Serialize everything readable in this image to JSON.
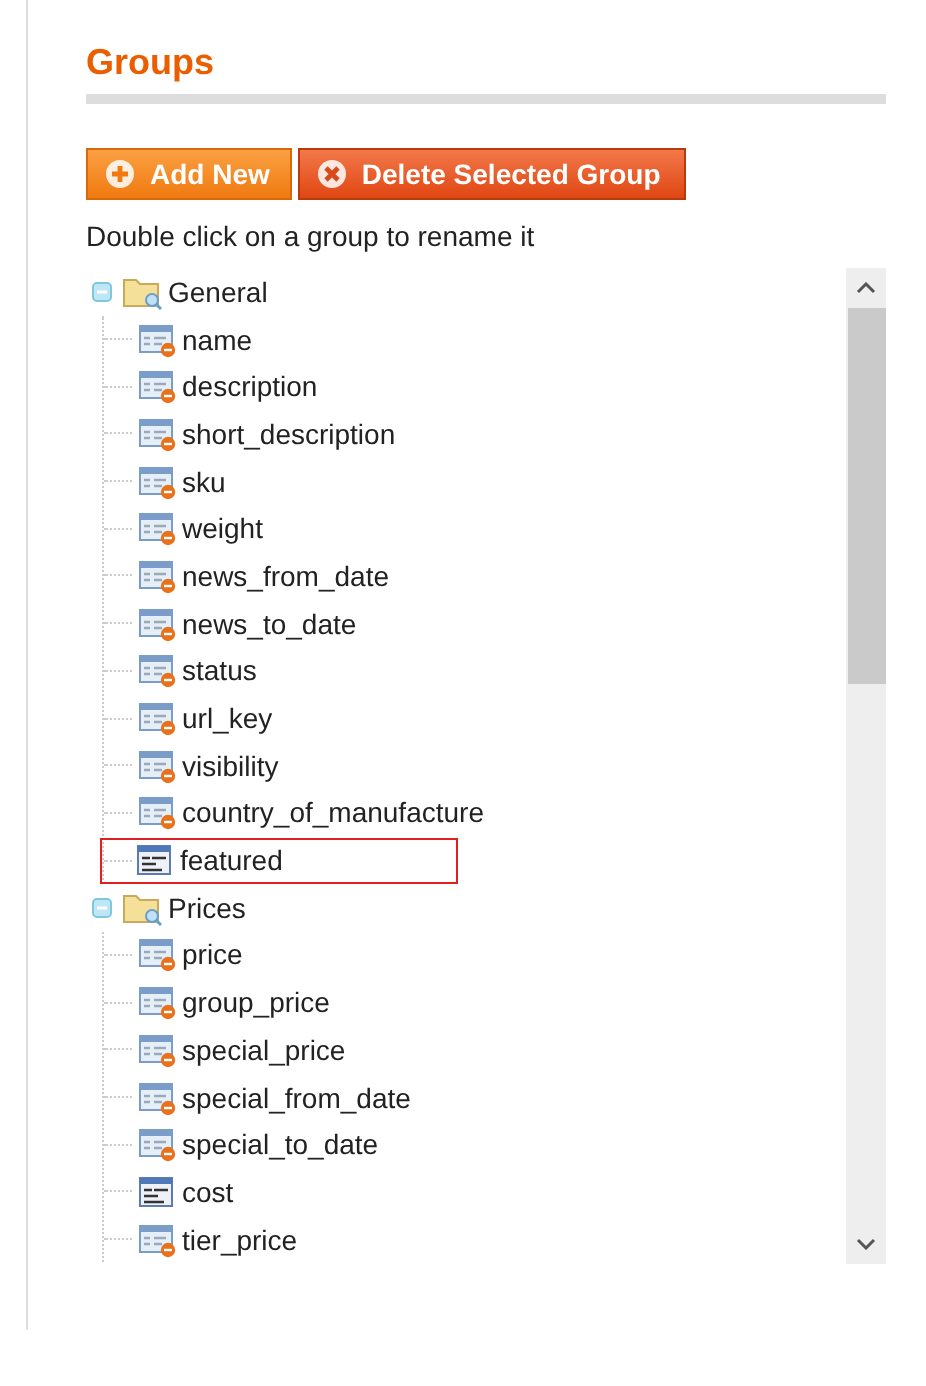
{
  "title": "Groups",
  "buttons": [
    {
      "label": "Add New",
      "kind": "add"
    },
    {
      "label": "Delete Selected Group",
      "kind": "delete"
    }
  ],
  "hint": "Double click on a group to rename it",
  "tree": [
    {
      "label": "General",
      "expanded": true,
      "children": [
        {
          "label": "name",
          "kind": "system",
          "selected": false
        },
        {
          "label": "description",
          "kind": "system",
          "selected": false
        },
        {
          "label": "short_description",
          "kind": "system",
          "selected": false
        },
        {
          "label": "sku",
          "kind": "system",
          "selected": false
        },
        {
          "label": "weight",
          "kind": "system",
          "selected": false
        },
        {
          "label": "news_from_date",
          "kind": "system",
          "selected": false
        },
        {
          "label": "news_to_date",
          "kind": "system",
          "selected": false
        },
        {
          "label": "status",
          "kind": "system",
          "selected": false
        },
        {
          "label": "url_key",
          "kind": "system",
          "selected": false
        },
        {
          "label": "visibility",
          "kind": "system",
          "selected": false
        },
        {
          "label": "country_of_manufacture",
          "kind": "system",
          "selected": false
        },
        {
          "label": "featured",
          "kind": "user",
          "selected": true
        }
      ]
    },
    {
      "label": "Prices",
      "expanded": true,
      "children": [
        {
          "label": "price",
          "kind": "system",
          "selected": false
        },
        {
          "label": "group_price",
          "kind": "system",
          "selected": false
        },
        {
          "label": "special_price",
          "kind": "system",
          "selected": false
        },
        {
          "label": "special_from_date",
          "kind": "system",
          "selected": false
        },
        {
          "label": "special_to_date",
          "kind": "system",
          "selected": false
        },
        {
          "label": "cost",
          "kind": "user",
          "selected": false
        },
        {
          "label": "tier_price",
          "kind": "system",
          "selected": false
        }
      ]
    }
  ]
}
